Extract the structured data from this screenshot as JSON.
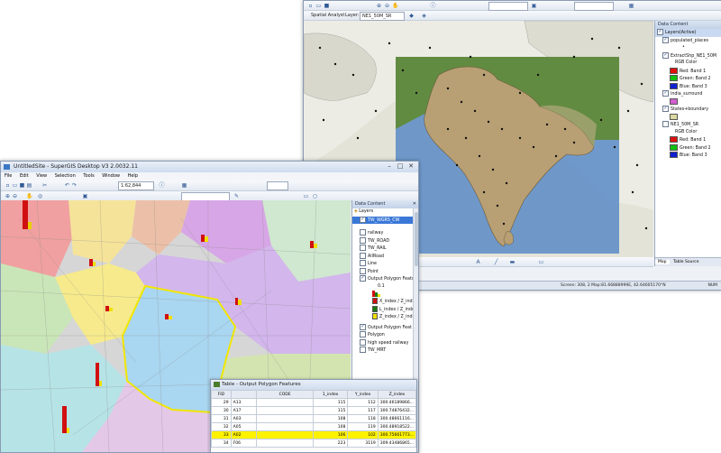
{
  "top_window": {
    "toolbar": {
      "spatial_analyst_label": "Spatial Analyst",
      "layer_label": "Layer:",
      "layer_value": "NE1_50M_SR"
    },
    "panel_title": "Data Content",
    "tree": {
      "root": "Layers(Active)",
      "items": [
        {
          "label": "populated_places",
          "checked": true
        },
        {
          "label": "ExtractShp_NE1_50M",
          "checked": true,
          "sub": "RGB Color",
          "bands": [
            {
              "label": "Red: Band 1",
              "color": "#e01010"
            },
            {
              "label": "Green: Band 2",
              "color": "#10c010"
            },
            {
              "label": "Blue: Band 3",
              "color": "#1020d0"
            }
          ]
        },
        {
          "label": "india_surround",
          "checked": true
        },
        {
          "label": "States+boundary",
          "checked": true
        },
        {
          "label": "NE1_50M_SR",
          "checked": false,
          "sub": "RGB Color",
          "bands": [
            {
              "label": "Red: Band 1",
              "color": "#e01010"
            },
            {
              "label": "Green: Band 2",
              "color": "#10c010"
            },
            {
              "label": "Blue: Band 3",
              "color": "#1020d0"
            }
          ]
        }
      ]
    },
    "tabs": [
      "Map",
      "Table Source"
    ],
    "status": "Screen: 308, 2   Map:81.66888999E, 42.64605170°N",
    "status_right": "NUM"
  },
  "bottom_window": {
    "title": "UntitledSite - SuperGIS Desktop V3 2.0032.11",
    "menu": [
      "File",
      "Edit",
      "View",
      "Selection",
      "Tools",
      "Window",
      "Help"
    ],
    "scale": "1:62,844",
    "panel_title": "Data Content",
    "tree": {
      "root": "Layers",
      "items": [
        {
          "label": "TW_WGRS_CW",
          "checked": true,
          "highlight": true
        },
        {
          "label": "railway",
          "checked": false
        },
        {
          "label": "TW_ROAD",
          "checked": false
        },
        {
          "label": "TW_RAIL",
          "checked": false
        },
        {
          "label": "AllRoad",
          "checked": false
        },
        {
          "label": "Line",
          "checked": false
        },
        {
          "label": "Point",
          "checked": false
        },
        {
          "label": "Output Polygon Featu",
          "checked": true
        }
      ],
      "legend_title": "0.1",
      "legend": [
        {
          "label": "X_index / Z_inde",
          "color": "#d01010"
        },
        {
          "label": "L_index / Z_inde",
          "color": "#1a7a10"
        },
        {
          "label": "Z_index / Z_inde",
          "color": "#f0e000"
        }
      ],
      "items2": [
        {
          "label": "Output Polygon Feat",
          "checked": true
        },
        {
          "label": "Polygon",
          "checked": false
        },
        {
          "label": "high speed railway",
          "checked": false
        },
        {
          "label": "TW_MRT",
          "checked": false
        }
      ]
    }
  },
  "table_window": {
    "title": "Table - Output Polygon Features",
    "columns": [
      "FID",
      "",
      "CODE",
      "1_index",
      "Y_index",
      "Z_index"
    ],
    "rows": [
      {
        "fid": "29",
        "id": "A13",
        "x": "115",
        "y": "112",
        "z": "300.46189866...",
        "sel": false
      },
      {
        "fid": "30",
        "id": "A17",
        "x": "115",
        "y": "117",
        "z": "300.74876432...",
        "sel": false
      },
      {
        "fid": "31",
        "id": "A03",
        "x": "108",
        "y": "118",
        "z": "300.48661116...",
        "sel": false
      },
      {
        "fid": "32",
        "id": "A05",
        "x": "108",
        "y": "119",
        "z": "300.48918522...",
        "sel": false
      },
      {
        "fid": "33",
        "id": "A02",
        "x": "106",
        "y": "102",
        "z": "300.75661773...",
        "sel": true
      },
      {
        "fid": "34",
        "id": "F06",
        "x": "223",
        "y": "3119",
        "z": "309.43486865...",
        "sel": false
      }
    ]
  },
  "colors": {
    "sea": "#6f96c8",
    "land_green": "#6b8a3c",
    "selection_outline": "#f2e600"
  }
}
